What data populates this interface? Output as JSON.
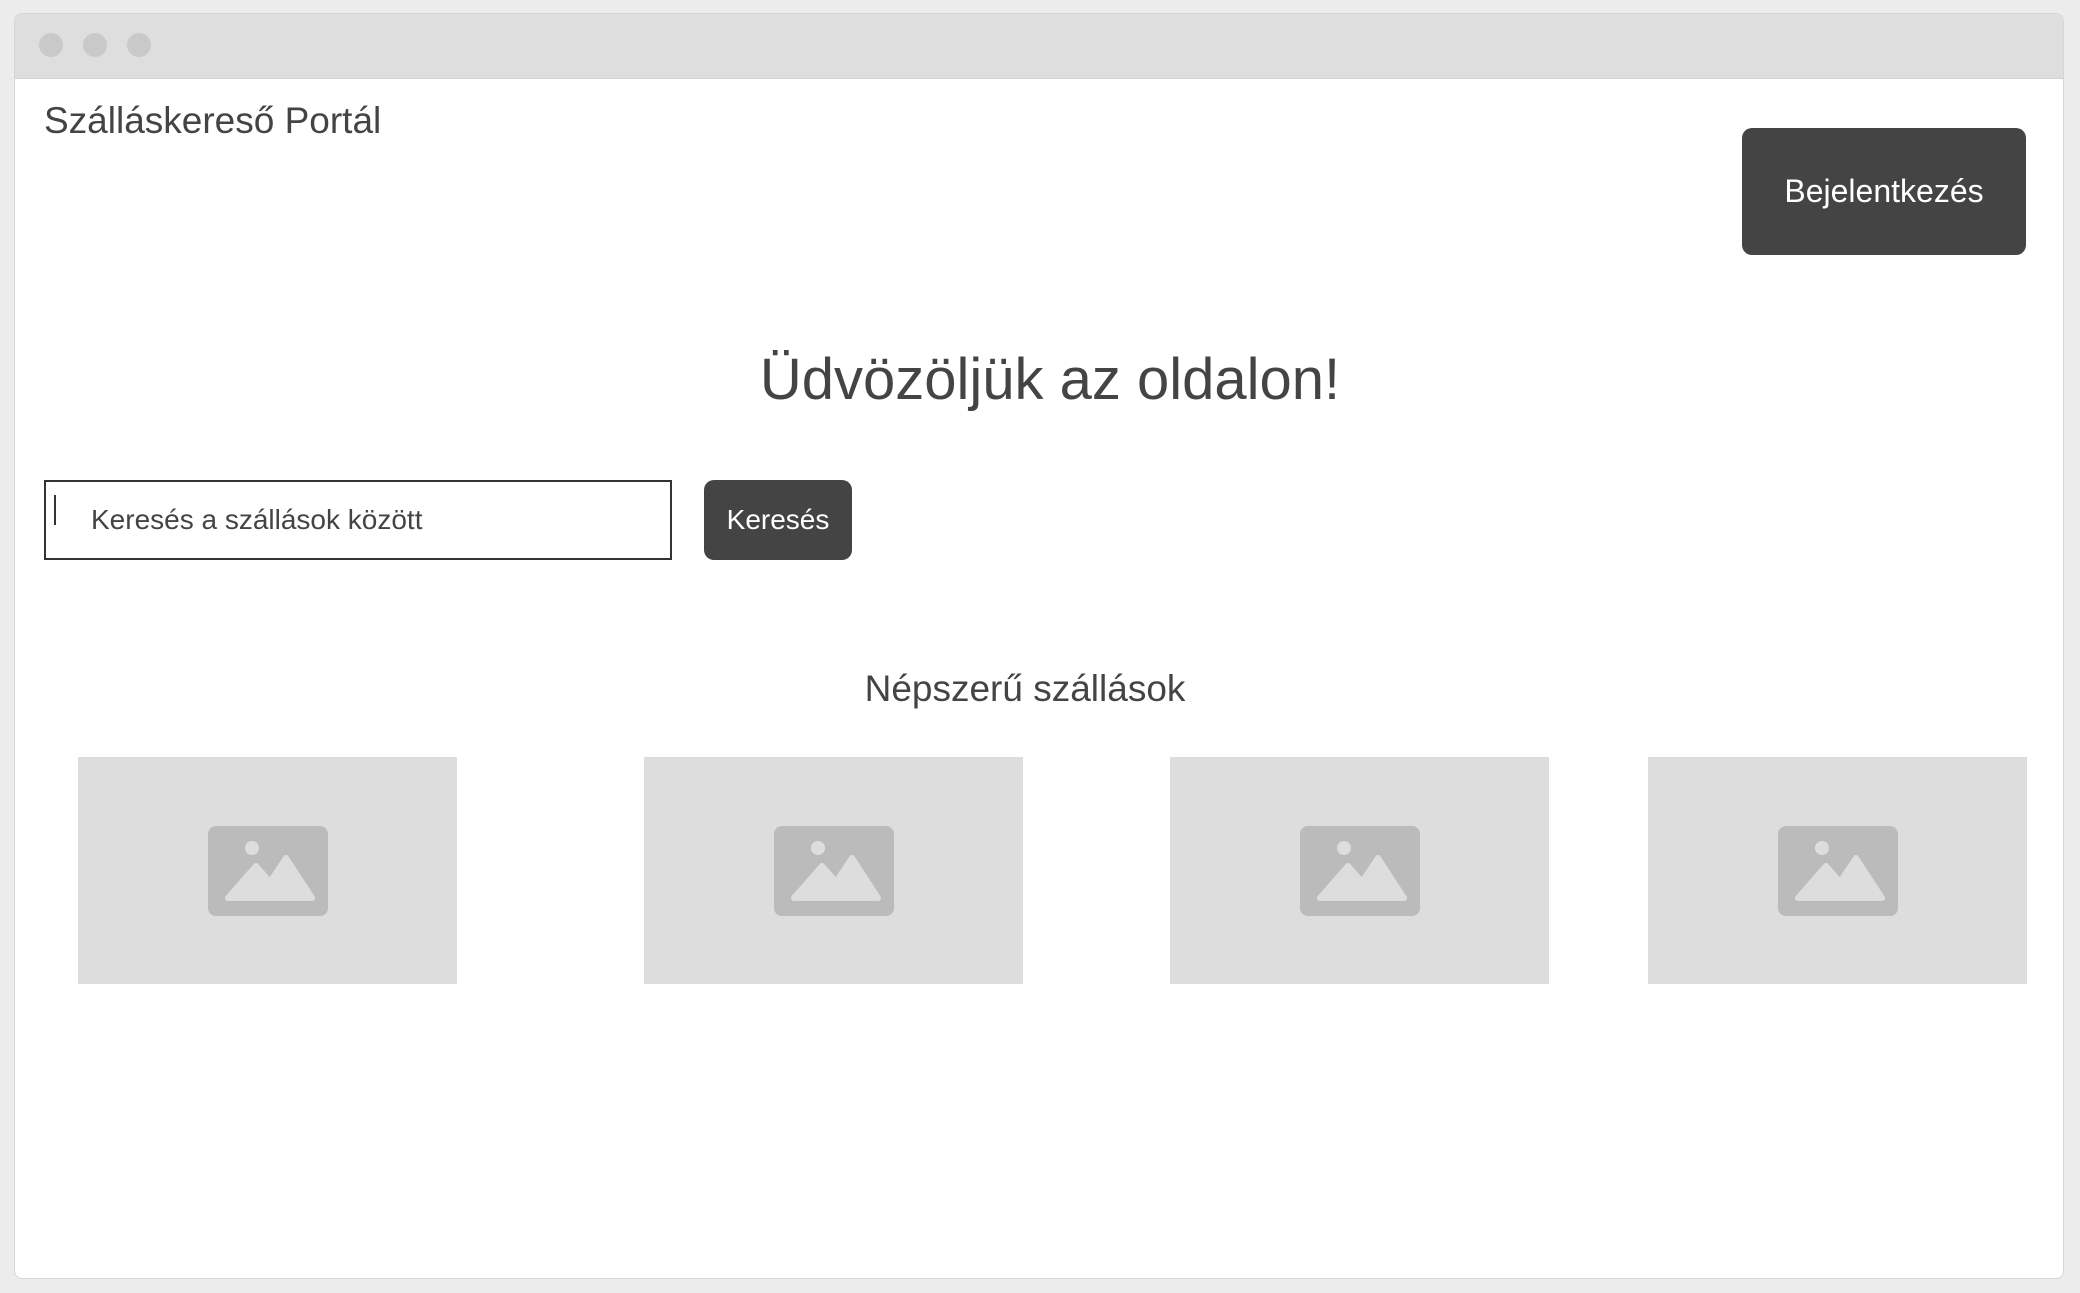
{
  "header": {
    "site_title": "Szálláskereső Portál",
    "login_label": "Bejelentkezés"
  },
  "hero": {
    "welcome": "Üdvözöljük az oldalon!"
  },
  "search": {
    "placeholder": "Keresés a szállások között",
    "button_label": "Keresés"
  },
  "popular": {
    "title": "Népszerű szállások",
    "cards": [
      {
        "icon": "image-placeholder-icon"
      },
      {
        "icon": "image-placeholder-icon"
      },
      {
        "icon": "image-placeholder-icon"
      },
      {
        "icon": "image-placeholder-icon"
      }
    ]
  },
  "colors": {
    "button_bg": "#444444",
    "placeholder_bg": "#dddddd",
    "placeholder_icon": "#bbbbbb",
    "titlebar": "#dedede"
  }
}
